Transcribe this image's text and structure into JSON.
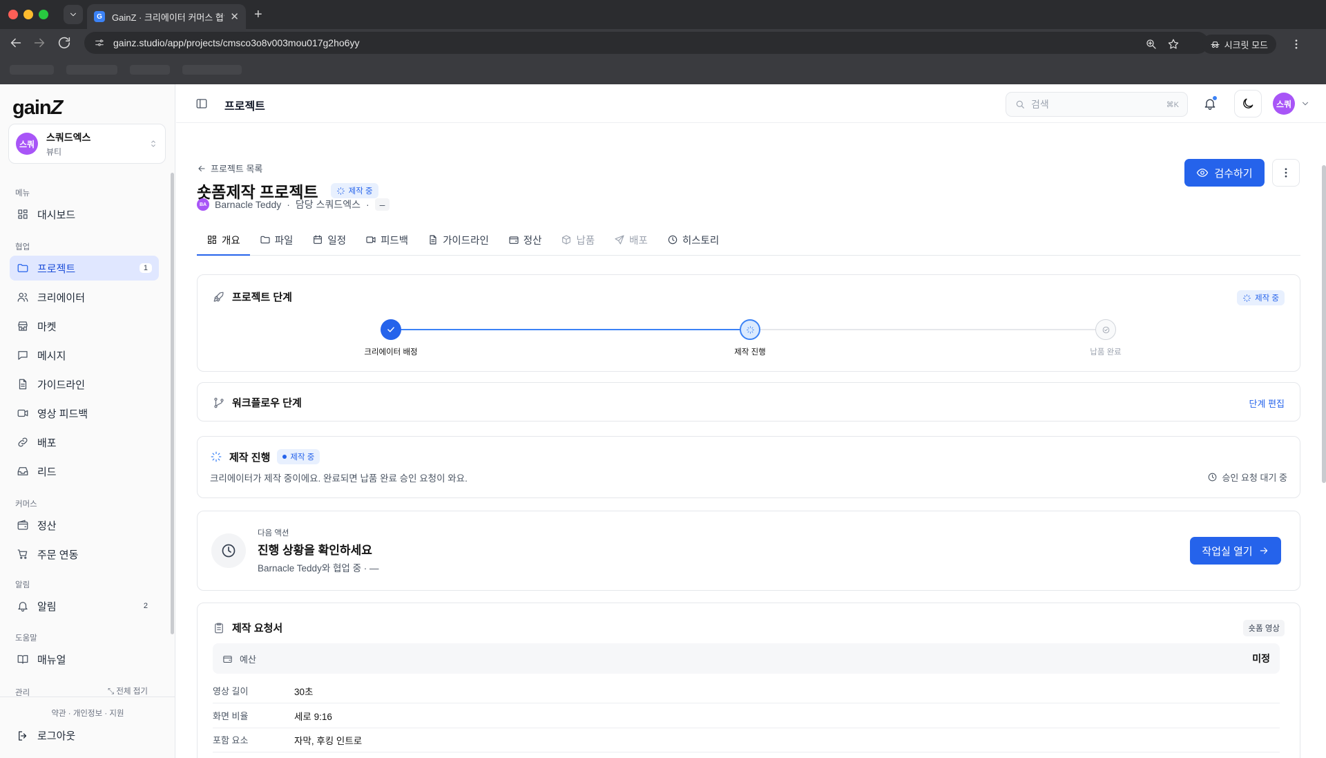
{
  "browser": {
    "tab_title": "GainZ · 크리에이터 커머스 협업 C",
    "favicon": "G",
    "url": "gainz.studio/app/projects/cmsco3o8v003mou017g2ho6yy",
    "secret_mode": "시크릿 모드"
  },
  "sidebar": {
    "logo": "gain",
    "workspace": {
      "avatar": "스쿼",
      "name": "스쿼드엑스",
      "category": "뷰티"
    },
    "sections": {
      "menu": "메뉴",
      "collab": "협업",
      "commerce": "커머스",
      "notify": "알림",
      "help": "도움말",
      "admin": "관리"
    },
    "items": {
      "dashboard": "대시보드",
      "projects": "프로젝트",
      "projects_count": "1",
      "creators": "크리에이터",
      "market": "마켓",
      "messages": "메시지",
      "guidelines": "가이드라인",
      "video_feedback": "영상 피드백",
      "distribution": "배포",
      "leads": "리드",
      "settlement": "정산",
      "order_sync": "주문 연동",
      "alerts": "알림",
      "alerts_count": "2",
      "manual": "매뉴얼"
    },
    "collapse_all": "전체 접기",
    "legal": "약관 · 개인정보 · 지원",
    "logout": "로그아웃"
  },
  "topbar": {
    "title": "프로젝트",
    "search_placeholder": "검색",
    "search_shortcut": "⌘K",
    "user_avatar": "스쿼"
  },
  "project": {
    "back_link": "프로젝트 목록",
    "title": "숏폼제작 프로젝트",
    "status": "제작 중",
    "creator_avatar": "BA",
    "creator": "Barnacle Teddy",
    "manager": "담당 스쿼드엑스",
    "extra": "–",
    "review_button": "검수하기"
  },
  "tabs": [
    {
      "label": "개요",
      "icon": "grid-icon"
    },
    {
      "label": "파일",
      "icon": "folder-icon"
    },
    {
      "label": "일정",
      "icon": "calendar-icon"
    },
    {
      "label": "피드백",
      "icon": "video-icon"
    },
    {
      "label": "가이드라인",
      "icon": "document-icon"
    },
    {
      "label": "정산",
      "icon": "wallet-icon"
    },
    {
      "label": "납품",
      "icon": "box-icon"
    },
    {
      "label": "배포",
      "icon": "send-icon"
    },
    {
      "label": "히스토리",
      "icon": "clock-icon"
    }
  ],
  "stages": {
    "title": "프로젝트 단계",
    "status": "제작 중",
    "steps": [
      "크리에이터 배정",
      "제작 진행",
      "납품 완료"
    ]
  },
  "workflow": {
    "title": "워크플로우 단계",
    "edit_link": "단계 편집"
  },
  "production": {
    "title": "제작 진행",
    "status": "제작 중",
    "description": "크리에이터가 제작 중이에요. 완료되면 납품 완료 승인 요청이 와요.",
    "note": "승인 요청 대기 중"
  },
  "next_action": {
    "label": "다음 액션",
    "title": "진행 상황을 확인하세요",
    "description": "Barnacle Teddy와 협업 중 · —",
    "button": "작업실 열기"
  },
  "brief": {
    "title": "제작 요청서",
    "tag": "숏폼 영상",
    "budget_label": "예산",
    "budget_value": "미정",
    "rows": [
      {
        "key": "영상 길이",
        "value": "30초"
      },
      {
        "key": "화면 비율",
        "value": "세로 9:16"
      },
      {
        "key": "포함 요소",
        "value": "자막, 후킹 인트로"
      }
    ]
  },
  "colors": {
    "accent": "#2563eb",
    "avatar": "#a855f7"
  }
}
